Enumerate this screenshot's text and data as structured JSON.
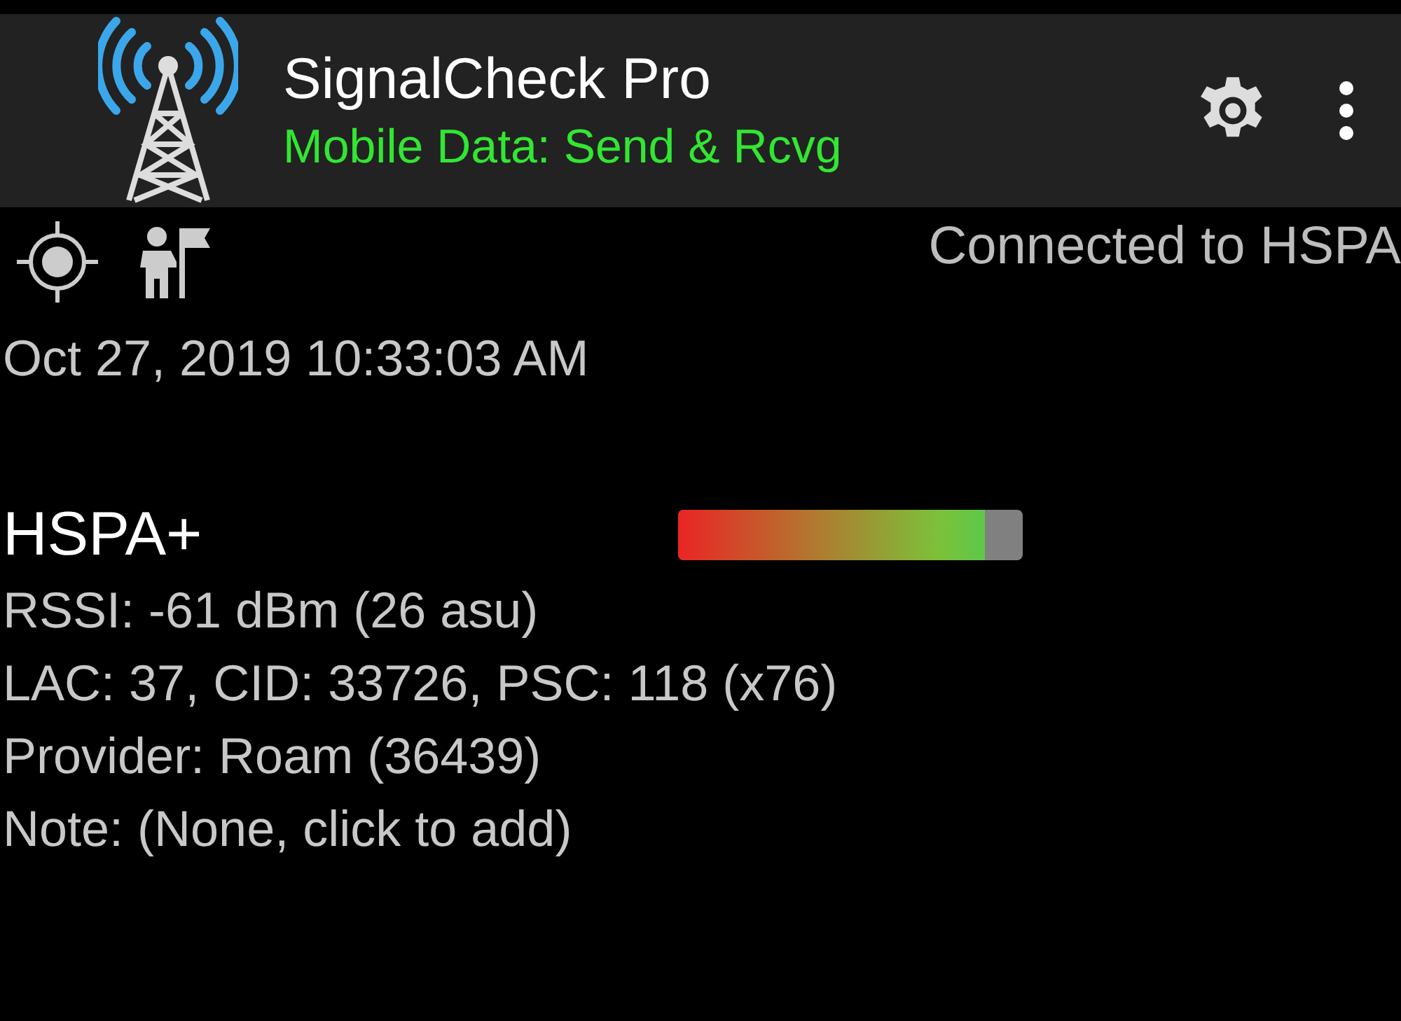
{
  "app_bar": {
    "title": "SignalCheck Pro",
    "subtitle": "Mobile Data: Send & Rcvg"
  },
  "status": {
    "connection": "Connected to HSPA",
    "timestamp": "Oct 27, 2019 10:33:03 AM"
  },
  "network": {
    "type": "HSPA+",
    "level": 0.89,
    "details": [
      "RSSI: -61 dBm (26 asu)",
      "LAC: 37, CID: 33726, PSC: 118 (x76)",
      "Provider: Roam (36439)",
      "Note: (None, click to add)"
    ]
  }
}
